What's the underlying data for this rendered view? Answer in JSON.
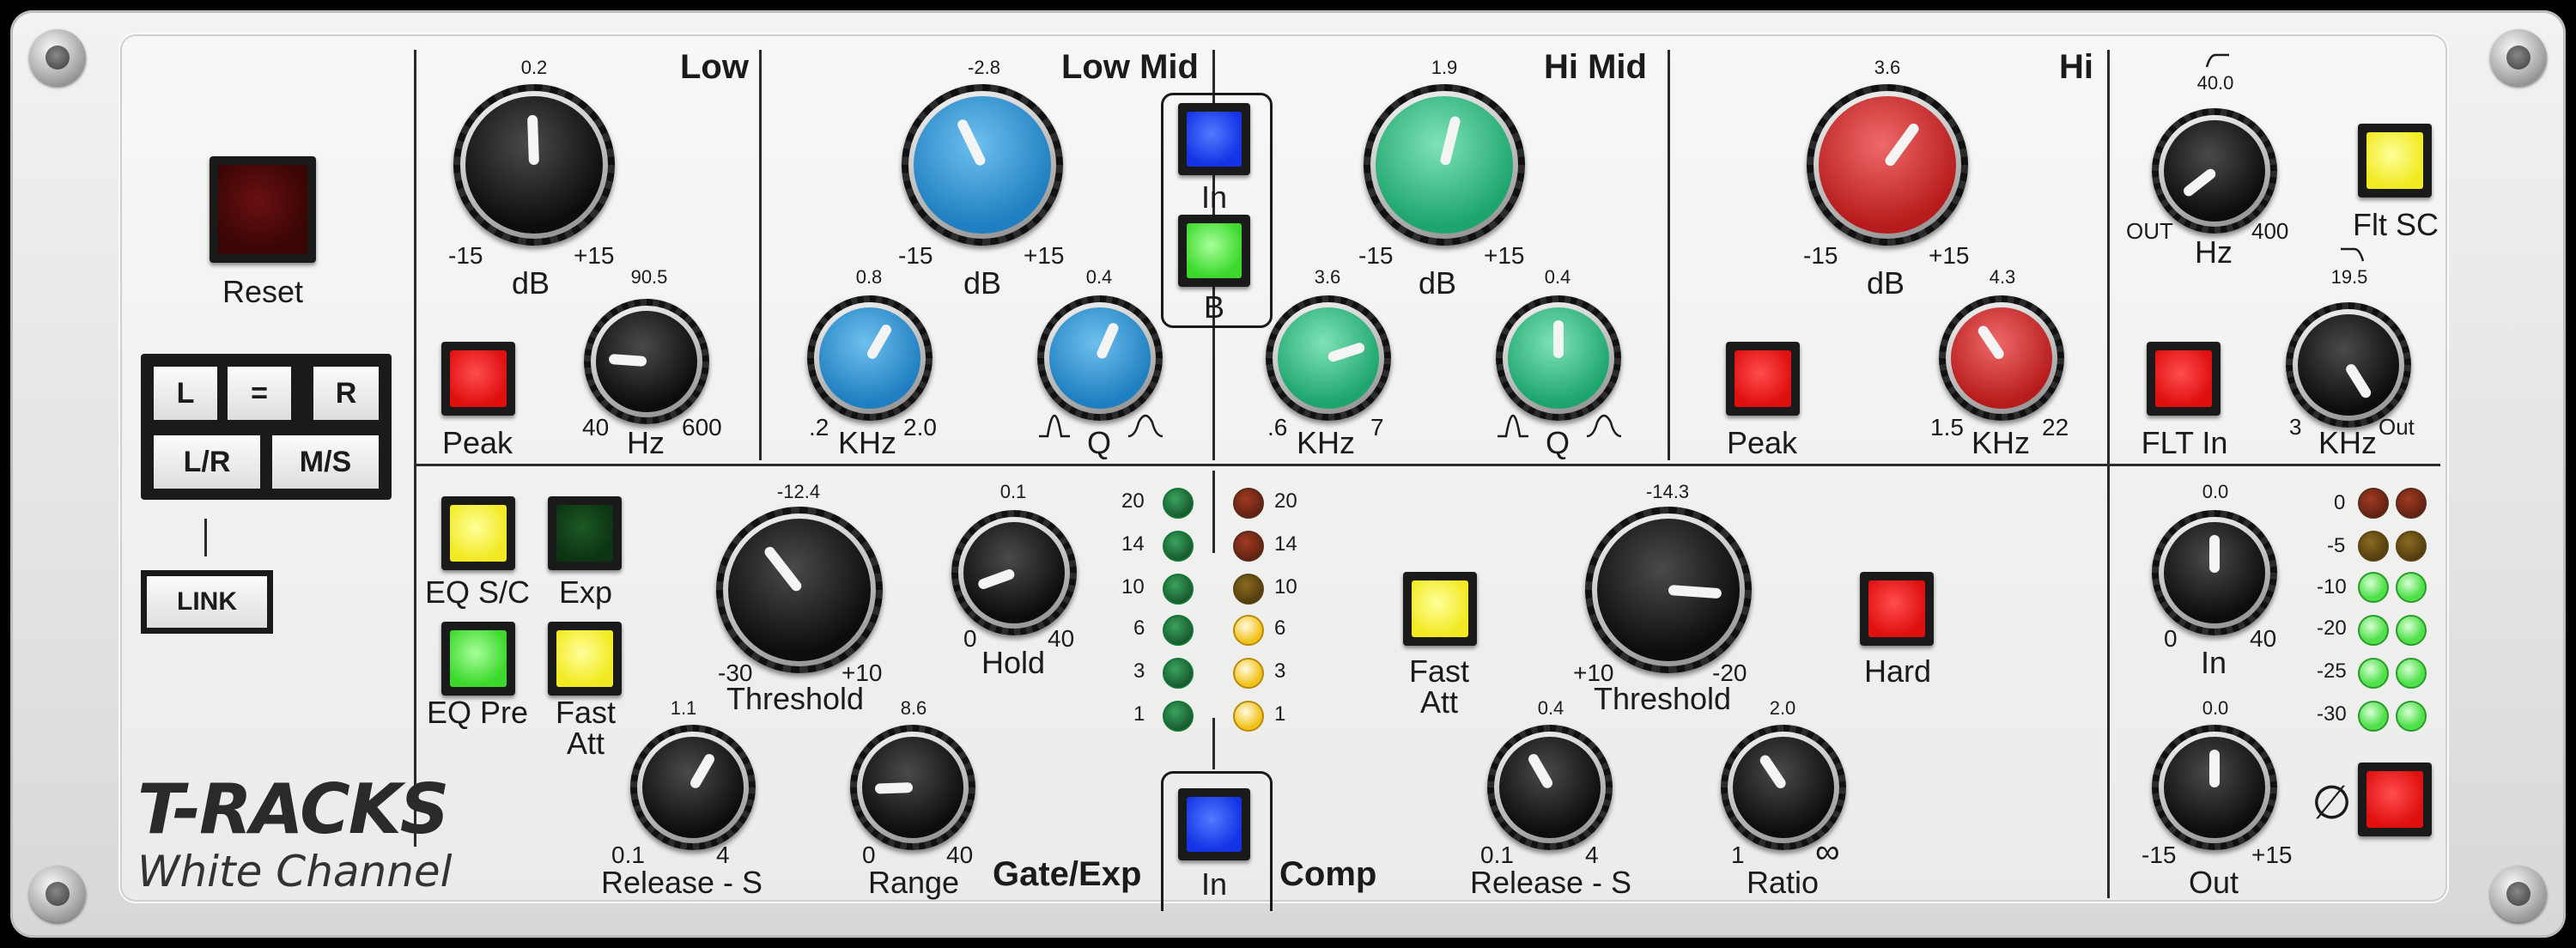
{
  "app": {
    "name_line1": "T-RACKS",
    "name_line2": "White Channel"
  },
  "sections": {
    "low": "Low",
    "low_mid": "Low Mid",
    "hi_mid": "Hi Mid",
    "hi": "Hi",
    "gate": "Gate/Exp",
    "comp": "Comp"
  },
  "left": {
    "reset": "Reset",
    "l": "L",
    "eq": "=",
    "r": "R",
    "lr": "L/R",
    "ms": "M/S",
    "link": "LINK"
  },
  "low": {
    "gain": {
      "value": "0.2",
      "min": "-15",
      "max": "+15",
      "unit": "dB"
    },
    "freq": {
      "value": "90.5",
      "min": "40",
      "max": "600",
      "unit": "Hz"
    },
    "peak": "Peak"
  },
  "low_mid": {
    "gain": {
      "value": "-2.8",
      "min": "-15",
      "max": "+15",
      "unit": "dB"
    },
    "freq": {
      "value": "0.8",
      "min": ".2",
      "max": "2.0",
      "unit": "KHz"
    },
    "q": {
      "value": "0.4",
      "unit": "Q"
    }
  },
  "mid_switch": {
    "in": "In",
    "b": "B"
  },
  "hi_mid": {
    "gain": {
      "value": "1.9",
      "min": "-15",
      "max": "+15",
      "unit": "dB"
    },
    "freq": {
      "value": "3.6",
      "min": ".6",
      "max": "7",
      "unit": "KHz"
    },
    "q": {
      "value": "0.4",
      "unit": "Q"
    }
  },
  "hi": {
    "gain": {
      "value": "3.6",
      "min": "-15",
      "max": "+15",
      "unit": "dB"
    },
    "freq": {
      "value": "4.3",
      "min": "1.5",
      "max": "22",
      "unit": "KHz"
    },
    "peak": "Peak"
  },
  "filters": {
    "hp": {
      "value": "40.0",
      "min": "OUT",
      "max": "400",
      "unit": "Hz"
    },
    "lp": {
      "value": "19.5",
      "min": "3",
      "max": "Out",
      "unit": "KHz"
    },
    "flt_sc": "Flt SC",
    "flt_in": "FLT In"
  },
  "gate": {
    "eq_sc": "EQ S/C",
    "exp": "Exp",
    "eq_pre": "EQ Pre",
    "fast_att_1": "Fast",
    "fast_att_2": "Att",
    "threshold": {
      "value": "-12.4",
      "min": "-30",
      "max": "+10",
      "label": "Threshold"
    },
    "hold": {
      "value": "0.1",
      "min": "0",
      "max": "40",
      "label": "Hold"
    },
    "release": {
      "value": "1.1",
      "min": "0.1",
      "max": "4",
      "label": "Release - S"
    },
    "range": {
      "value": "8.6",
      "min": "0",
      "max": "40",
      "label": "Range"
    },
    "meter": [
      "20",
      "14",
      "10",
      "6",
      "3",
      "1"
    ]
  },
  "gc_in": "In",
  "comp": {
    "meter": [
      "20",
      "14",
      "10",
      "6",
      "3",
      "1"
    ],
    "fast_att_1": "Fast",
    "fast_att_2": "Att",
    "threshold": {
      "value": "-14.3",
      "min": "+10",
      "max": "-20",
      "label": "Threshold"
    },
    "hard": "Hard",
    "release": {
      "value": "0.4",
      "min": "0.1",
      "max": "4",
      "label": "Release - S"
    },
    "ratio": {
      "value": "2.0",
      "min": "1",
      "max": "∞",
      "label": "Ratio"
    }
  },
  "output": {
    "in": {
      "value": "0.0",
      "min": "0",
      "max": "40",
      "label": "In"
    },
    "out": {
      "value": "0.0",
      "min": "-15",
      "max": "+15",
      "label": "Out"
    },
    "meter": [
      "0",
      "-5",
      "-10",
      "-20",
      "-25",
      "-30"
    ],
    "phase": "∅"
  }
}
